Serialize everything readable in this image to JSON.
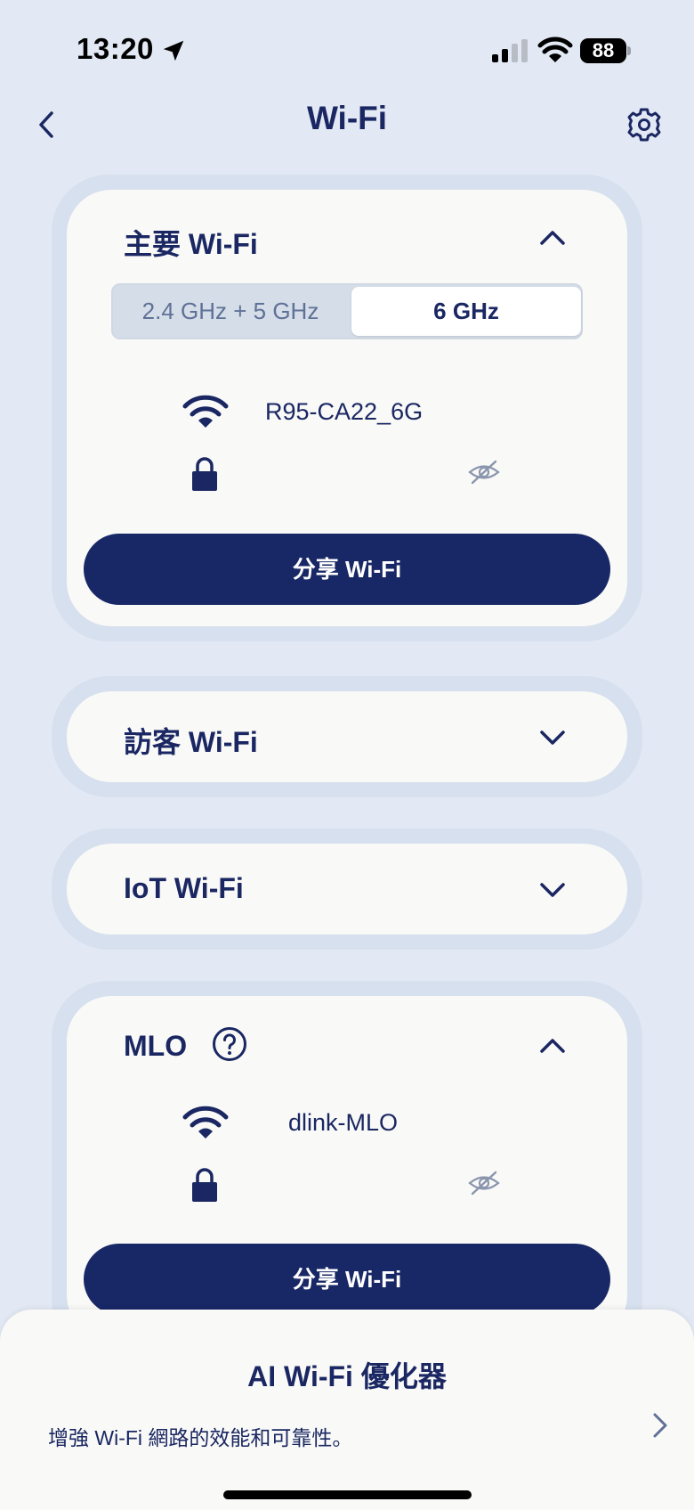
{
  "status_bar": {
    "time": "13:20",
    "battery": "88",
    "icons": [
      "location-arrow-icon",
      "signal-icon",
      "wifi-icon",
      "battery-icon"
    ]
  },
  "header": {
    "title": "Wi-Fi",
    "back_icon": "chevron-left-icon",
    "settings_icon": "gear-icon"
  },
  "main_wifi": {
    "title": "主要 Wi-Fi",
    "expanded": true,
    "bands": [
      "2.4 GHz + 5 GHz",
      "6 GHz"
    ],
    "selected_band": "6 GHz",
    "ssid": "R95-CA22_6G",
    "password_hidden": true,
    "share_label": "分享 Wi-Fi"
  },
  "guest_wifi": {
    "title": "訪客 Wi-Fi",
    "expanded": false
  },
  "iot_wifi": {
    "title": "IoT Wi-Fi",
    "expanded": false
  },
  "mlo": {
    "title": "MLO",
    "help_icon": "help-circle-icon",
    "expanded": true,
    "ssid": "dlink-MLO",
    "password_hidden": true,
    "share_label": "分享 Wi-Fi"
  },
  "bottom_sheet": {
    "title": "AI Wi-Fi 優化器",
    "description": "增強 Wi-Fi 網路的效能和可靠性。",
    "chevron_icon": "chevron-right-icon"
  },
  "colors": {
    "background": "#e3e9f4",
    "card_border": "#d6e0ee",
    "card": "#f9f9f7",
    "primary": "#1a2762",
    "button": "#182766",
    "muted_text": "#5f7196"
  }
}
